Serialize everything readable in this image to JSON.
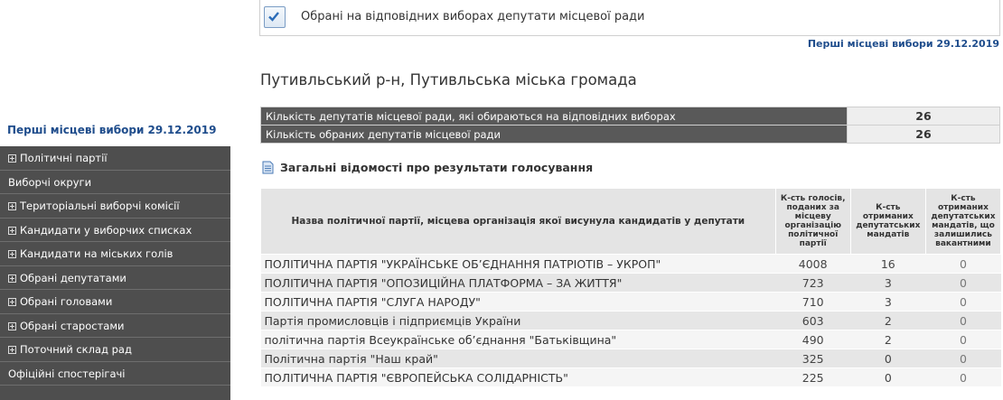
{
  "header": {
    "title": "Обрані на відповідних виборах депутати місцевої ради",
    "election_link": "Перші місцеві вибори 29.12.2019",
    "icon": "checkbox-icon"
  },
  "region_title": "Путивльський р-н, Путивльська міська громада",
  "sidebar": {
    "title": "Перші місцеві вибори 29.12.2019",
    "items": [
      {
        "label": "Політичні партії",
        "expandable": true
      },
      {
        "label": "Виборчі округи",
        "expandable": false
      },
      {
        "label": "Територіальні виборчі комісії",
        "expandable": true
      },
      {
        "label": "Кандидати у виборчих списках",
        "expandable": true
      },
      {
        "label": "Кандидати на міських голів",
        "expandable": true
      },
      {
        "label": "Обрані депутатами",
        "expandable": true
      },
      {
        "label": "Обрані головами",
        "expandable": true
      },
      {
        "label": "Обрані старостами",
        "expandable": true
      },
      {
        "label": "Поточний склад рад",
        "expandable": true
      },
      {
        "label": "Офіційні спостерігачі",
        "expandable": false
      }
    ]
  },
  "summary": [
    {
      "label": "Кількість депутатів місцевої ради, які обираються на відповідних виборах",
      "value": "26"
    },
    {
      "label": "Кількість обраних депутатів місцевої ради",
      "value": "26"
    }
  ],
  "section_title": "Загальні відомості про результати голосування",
  "results": {
    "headers": [
      "Назва політичної партії, місцева організація якої висунула кандидатів у депутати",
      "К-сть голосів, поданих за місцеву організацію політичної партії",
      "К-сть отриманих депутатських мандатів",
      "К-сть отриманих депутатських мандатів, що залишились вакантними"
    ],
    "rows": [
      {
        "party": "ПОЛІТИЧНА ПАРТІЯ \"УКРАЇНСЬКЕ ОБ’ЄДНАННЯ ПАТРІОТІВ – УКРОП\"",
        "votes": "4008",
        "mandates": "16",
        "vacant": "0"
      },
      {
        "party": "ПОЛІТИЧНА ПАРТІЯ \"ОПОЗИЦІЙНА ПЛАТФОРМА – ЗА ЖИТТЯ\"",
        "votes": "723",
        "mandates": "3",
        "vacant": "0"
      },
      {
        "party": "ПОЛІТИЧНА ПАРТІЯ \"СЛУГА НАРОДУ\"",
        "votes": "710",
        "mandates": "3",
        "vacant": "0"
      },
      {
        "party": "Партія промисловців і підприємців України",
        "votes": "603",
        "mandates": "2",
        "vacant": "0"
      },
      {
        "party": "політична партія Всеукраїнське об’єднання \"Батьківщина\"",
        "votes": "490",
        "mandates": "2",
        "vacant": "0"
      },
      {
        "party": "Політична партія \"Наш край\"",
        "votes": "325",
        "mandates": "0",
        "vacant": "0"
      },
      {
        "party": "ПОЛІТИЧНА ПАРТІЯ \"ЄВРОПЕЙСЬКА СОЛІДАРНІСТЬ\"",
        "votes": "225",
        "mandates": "0",
        "vacant": "0"
      }
    ]
  }
}
